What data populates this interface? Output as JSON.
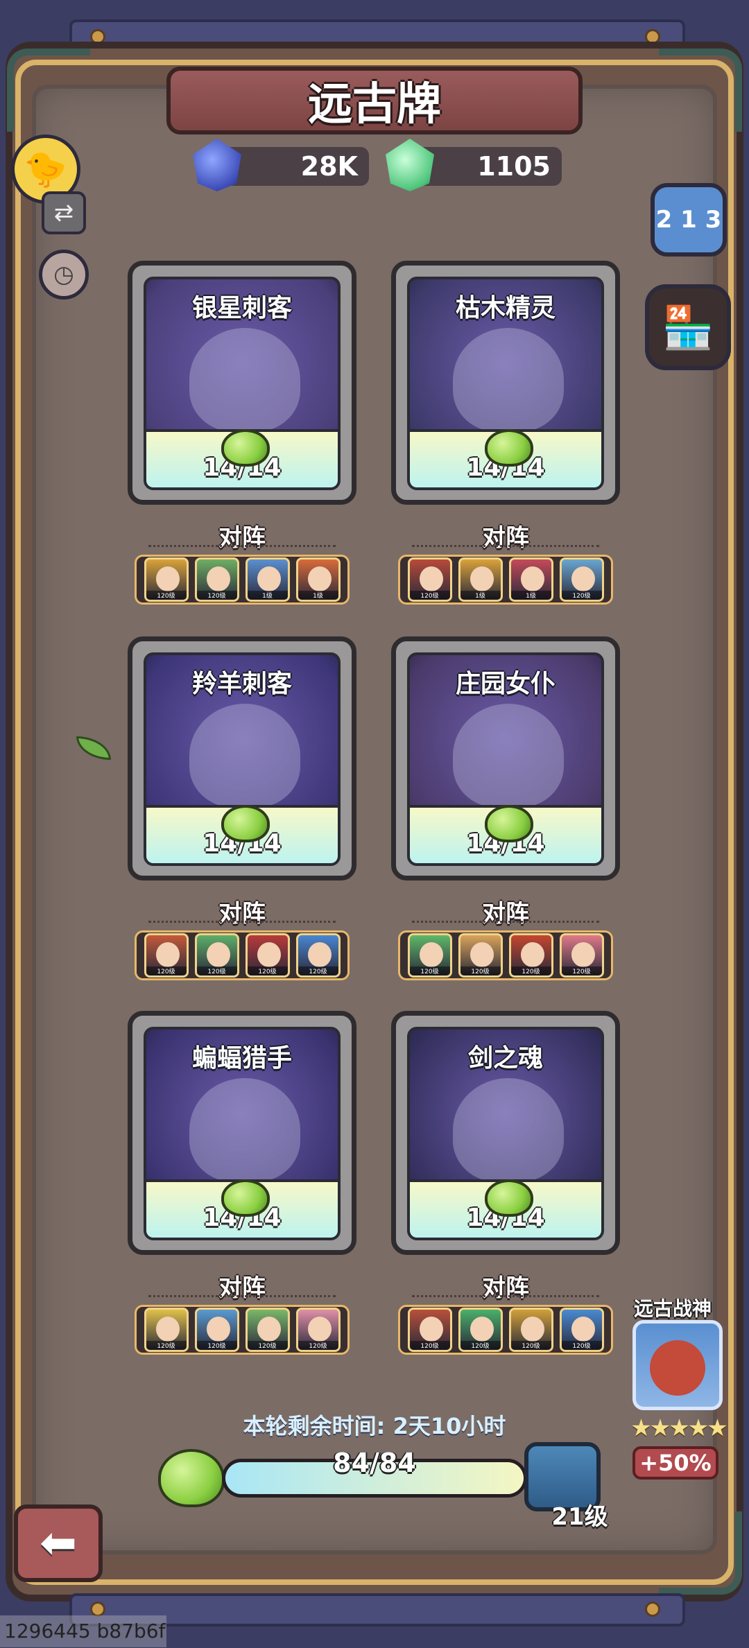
{
  "title": "远古牌",
  "currency": {
    "blue": {
      "icon": "blue-crystal-icon",
      "amount": "28K"
    },
    "green": {
      "icon": "green-crystal-icon",
      "amount": "1105"
    }
  },
  "cards": [
    {
      "name": "银星刺客",
      "count": "14/14",
      "lineup_label": "对阵",
      "art_color": "#4b3f7a",
      "heroes": [
        {
          "lvl": "120级",
          "color": "#d9a23a"
        },
        {
          "lvl": "120级",
          "color": "#6fae63"
        },
        {
          "lvl": "1级",
          "color": "#5b8fd0"
        },
        {
          "lvl": "1级",
          "color": "#d86b3a"
        }
      ]
    },
    {
      "name": "枯木精灵",
      "count": "14/14",
      "lineup_label": "对阵",
      "art_color": "#3d3a6a",
      "heroes": [
        {
          "lvl": "120级",
          "color": "#b84a3a"
        },
        {
          "lvl": "1级",
          "color": "#d9a23a"
        },
        {
          "lvl": "1级",
          "color": "#c44a5a"
        },
        {
          "lvl": "120级",
          "color": "#6aa6d0"
        }
      ]
    },
    {
      "name": "羚羊刺客",
      "count": "14/14",
      "lineup_label": "对阵",
      "art_color": "#3d3678",
      "heroes": [
        {
          "lvl": "120级",
          "color": "#c45a3a"
        },
        {
          "lvl": "120级",
          "color": "#5fae6a"
        },
        {
          "lvl": "120级",
          "color": "#b83a3a"
        },
        {
          "lvl": "120级",
          "color": "#4a86d0"
        }
      ]
    },
    {
      "name": "庄园女仆",
      "count": "14/14",
      "lineup_label": "对阵",
      "art_color": "#4a3a6a",
      "heroes": [
        {
          "lvl": "120级",
          "color": "#5fb86a"
        },
        {
          "lvl": "120级",
          "color": "#d8a35a"
        },
        {
          "lvl": "120级",
          "color": "#c4462f"
        },
        {
          "lvl": "120级",
          "color": "#e07a88"
        }
      ]
    },
    {
      "name": "蝙蝠猎手",
      "count": "14/14",
      "lineup_label": "对阵",
      "art_color": "#3a3370",
      "heroes": [
        {
          "lvl": "120级",
          "color": "#e0c04a"
        },
        {
          "lvl": "120级",
          "color": "#5a9ad0"
        },
        {
          "lvl": "120级",
          "color": "#7ab86a"
        },
        {
          "lvl": "120级",
          "color": "#e090a8"
        }
      ]
    },
    {
      "name": "剑之魂",
      "count": "14/14",
      "lineup_label": "对阵",
      "art_color": "#34305e",
      "heroes": [
        {
          "lvl": "120级",
          "color": "#b8503a"
        },
        {
          "lvl": "120级",
          "color": "#4ab06a"
        },
        {
          "lvl": "120级",
          "color": "#d0a03a"
        },
        {
          "lvl": "120级",
          "color": "#4a8ad0"
        }
      ]
    }
  ],
  "side_buttons": {
    "duck": "duck-avatar-icon",
    "swap": "swap-arrows-icon",
    "clock": "clock-icon",
    "ranking": "podium-ranking-icon",
    "shop": "shop-stall-icon"
  },
  "timer": "本轮剩余时间: 2天10小时",
  "progress": {
    "text": "84/84",
    "fraction": 1.0
  },
  "chest": {
    "level": "21级"
  },
  "war_god": {
    "title": "远古战神",
    "stars": "★★★★★",
    "bonus": "+50%"
  },
  "back_icon": "back-arrow-icon",
  "footer_id": "1296445 b87b6f",
  "colors": {
    "board": "#7b6c66",
    "frame": "#6e5549",
    "accent_gold": "#d9b36a",
    "banner": "#8a4c4c"
  }
}
